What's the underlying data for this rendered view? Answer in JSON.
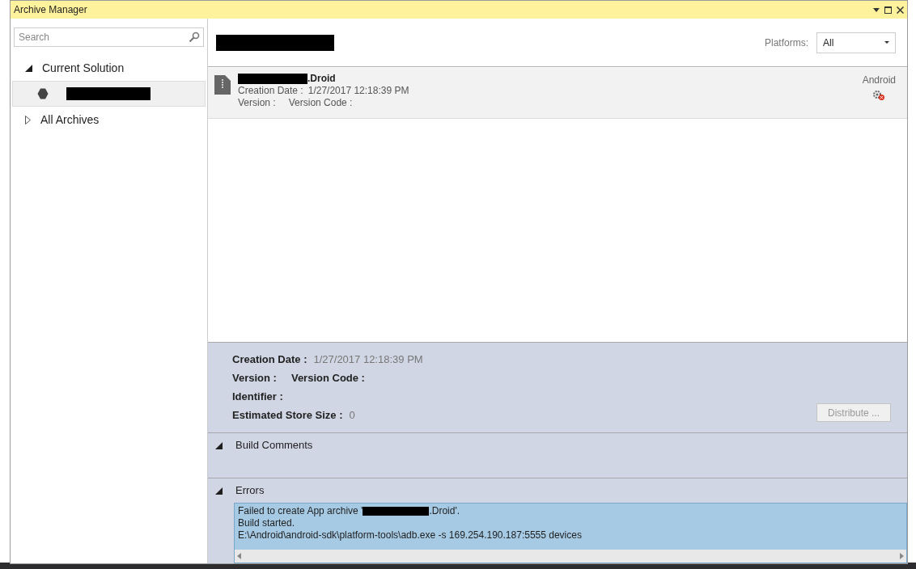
{
  "window": {
    "title": "Archive Manager"
  },
  "search": {
    "placeholder": "Search"
  },
  "tree": [
    {
      "label": "Current Solution",
      "expanded": true,
      "children": [
        {
          "kind": "project",
          "selected": true
        }
      ]
    },
    {
      "label": "All Archives",
      "expanded": false
    }
  ],
  "platforms": {
    "label": "Platforms:",
    "value": "All"
  },
  "archives": [
    {
      "name_suffix": ".Droid",
      "creation_label": "Creation Date :",
      "creation_value": "1/27/2017 12:18:39 PM",
      "version_label": "Version :",
      "version_code_label": "Version Code :",
      "platform": "Android",
      "selected": true
    }
  ],
  "details": {
    "rows": [
      [
        {
          "label": "Creation Date :",
          "value": "1/27/2017 12:18:39 PM"
        }
      ],
      [
        {
          "label": "Version :"
        },
        {
          "label": "Version Code :"
        }
      ],
      [
        {
          "label": "Identifier :"
        }
      ],
      [
        {
          "label": "Estimated Store Size :",
          "value": "0"
        }
      ]
    ],
    "distribute": {
      "label": "Distribute ...",
      "disabled": true
    }
  },
  "sections": [
    {
      "title": "Build Comments",
      "expanded": true
    },
    {
      "title": "Errors",
      "expanded": true,
      "lines": [
        {
          "before": "Failed to create App archive '",
          "redacted": true,
          "after": ".Droid'."
        },
        {
          "before": "Build started."
        },
        {
          "before": "E:\\Android\\android-sdk\\platform-tools\\adb.exe -s 169.254.190.187:5555 devices"
        }
      ]
    }
  ]
}
